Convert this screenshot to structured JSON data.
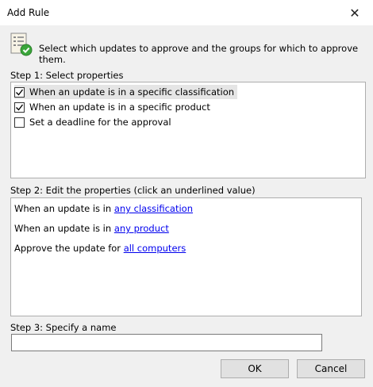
{
  "window": {
    "title": "Add Rule"
  },
  "header": {
    "text": "Select which updates to approve and the groups for which to approve them.",
    "icon": "checklist-icon"
  },
  "step1": {
    "label": "Step 1: Select properties",
    "items": [
      {
        "label": "When an update is in a specific classification",
        "checked": true
      },
      {
        "label": "When an update is in a specific product",
        "checked": true
      },
      {
        "label": "Set a deadline for the approval",
        "checked": false
      }
    ]
  },
  "step2": {
    "label": "Step 2: Edit the properties (click an underlined value)",
    "lines": [
      {
        "prefix": "When an update is in ",
        "link": "any classification"
      },
      {
        "prefix": "When an update is in ",
        "link": "any product"
      },
      {
        "prefix": "Approve the update for ",
        "link": "all computers"
      }
    ]
  },
  "step3": {
    "label": "Step 3: Specify a name",
    "value": ""
  },
  "buttons": {
    "ok": "OK",
    "cancel": "Cancel"
  },
  "colors": {
    "link": "#0000ee",
    "check_green": "#3aa63a"
  }
}
